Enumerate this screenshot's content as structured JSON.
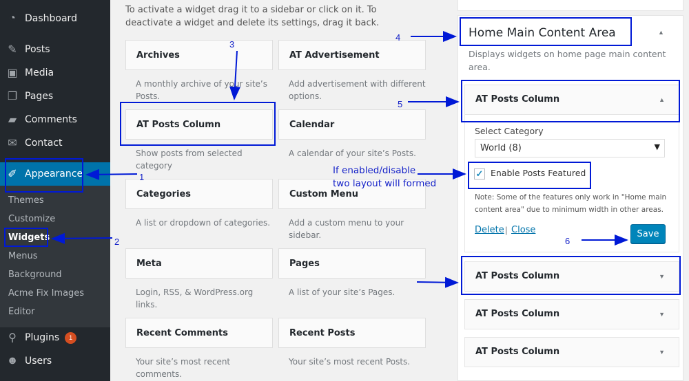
{
  "sidebar": {
    "items": [
      {
        "label": "Dashboard",
        "icon": "dashboard-icon"
      },
      {
        "label": "Posts",
        "icon": "pin-icon"
      },
      {
        "label": "Media",
        "icon": "media-icon"
      },
      {
        "label": "Pages",
        "icon": "pages-icon"
      },
      {
        "label": "Comments",
        "icon": "comment-icon"
      },
      {
        "label": "Contact",
        "icon": "mail-icon"
      },
      {
        "label": "Appearance",
        "icon": "brush-icon"
      },
      {
        "label": "Plugins",
        "icon": "plugin-icon",
        "badge": "1"
      },
      {
        "label": "Users",
        "icon": "user-icon"
      }
    ],
    "submenu": [
      "Themes",
      "Customize",
      "Widgets",
      "Menus",
      "Background",
      "Acme Fix Images",
      "Editor"
    ]
  },
  "main": {
    "intro": "To activate a widget drag it to a sidebar or click on it. To deactivate a widget and delete its settings, drag it back.",
    "widgets": [
      {
        "title": "Archives",
        "desc": "A monthly archive of your site’s Posts."
      },
      {
        "title": "AT Advertisement",
        "desc": "Add advertisement with different options."
      },
      {
        "title": "AT Posts Column",
        "desc": "Show posts from selected category"
      },
      {
        "title": "Calendar",
        "desc": "A calendar of your site’s Posts."
      },
      {
        "title": "Categories",
        "desc": "A list or dropdown of categories."
      },
      {
        "title": "Custom Menu",
        "desc": "Add a custom menu to your sidebar."
      },
      {
        "title": "Meta",
        "desc": "Login, RSS, & WordPress.org links."
      },
      {
        "title": "Pages",
        "desc": "A list of your site’s Pages."
      },
      {
        "title": "Recent Comments",
        "desc": "Your site’s most recent comments."
      },
      {
        "title": "Recent Posts",
        "desc": "Your site’s most recent Posts."
      }
    ]
  },
  "area": {
    "title": "Home Main Content Area",
    "desc": "Displays widgets on home page main content area.",
    "widget_title": "AT Posts Column",
    "select_label": "Select Category",
    "select_value": "World  (8)",
    "checkbox_label": "Enable Posts Featured",
    "checkbox_checked": true,
    "note": "Note: Some of the features only work in \"Home main content area\" due to minimum width in other areas.",
    "delete": "Delete",
    "separator": "|",
    "close": "Close",
    "save": "Save",
    "collapsed": [
      "AT Posts Column",
      "AT Posts Column",
      "AT Posts Column"
    ]
  },
  "annotations": {
    "n1": "1",
    "n2": "2",
    "n3": "3",
    "n4": "4",
    "n5": "5",
    "n6": "6",
    "note_line1": "If enabled/disable",
    "note_line2": "two layout will formed"
  },
  "colors": {
    "admin_bar": "#23282d",
    "accent": "#0073aa",
    "annotation": "#0019d6",
    "badge": "#d54e21"
  }
}
